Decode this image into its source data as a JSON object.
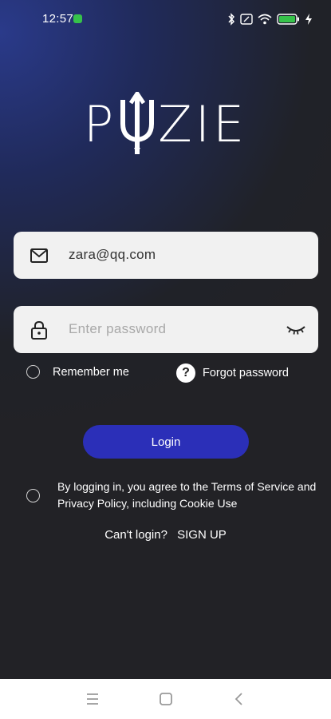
{
  "status_bar": {
    "time": "12:57"
  },
  "logo": {
    "text_left": "P",
    "text_right": "ZIE"
  },
  "email_field": {
    "value": "zara@qq.com",
    "placeholder": "Email"
  },
  "password_field": {
    "value": "",
    "placeholder": "Enter password"
  },
  "remember_label": "Remember me",
  "forgot_label": "Forgot password",
  "login_label": "Login",
  "terms_text": "By logging in, you agree to the Terms of Service and Privacy Policy, including Cookie Use",
  "cant_login_label": "Can't login?",
  "signup_label": "SIGN UP",
  "colors": {
    "accent": "#2b2fb8",
    "background": "#222226"
  },
  "icons": [
    "mail-icon",
    "lock-icon",
    "eye-closed-icon",
    "help-icon",
    "bluetooth-icon",
    "wifi-icon",
    "battery-icon",
    "menu-icon",
    "home-icon",
    "back-icon"
  ]
}
